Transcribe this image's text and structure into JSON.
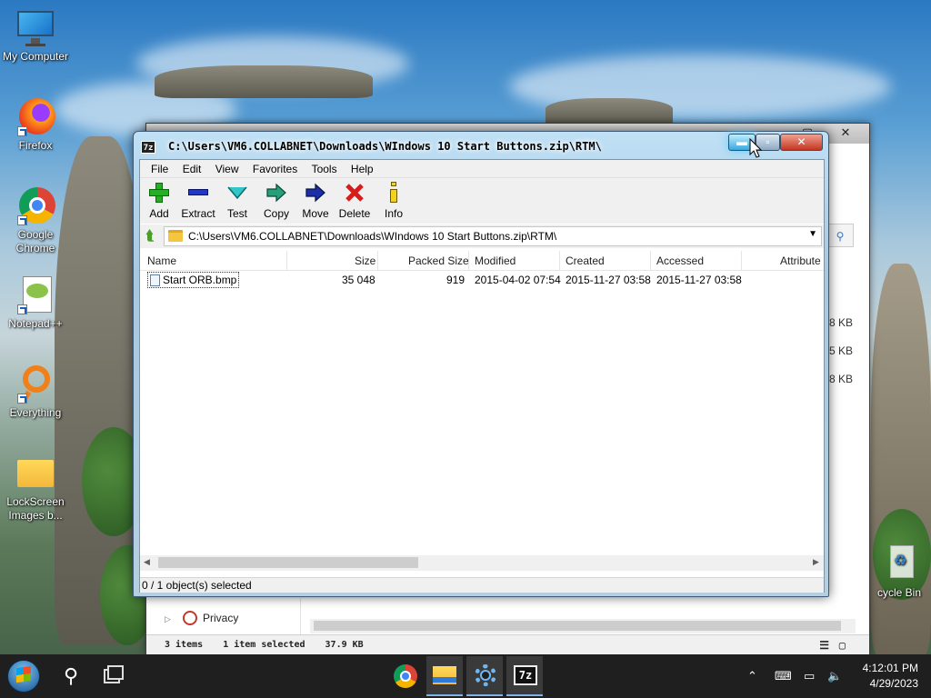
{
  "desktop": {
    "icons": [
      {
        "label": "My Computer",
        "icon": "monitor-icon"
      },
      {
        "label": "Firefox",
        "icon": "firefox-icon"
      },
      {
        "label": "Google Chrome",
        "icon": "chrome-icon"
      },
      {
        "label": "Notepad++",
        "icon": "notepadpp-icon"
      },
      {
        "label": "Everything",
        "icon": "everything-icon"
      },
      {
        "label": "LockScreen Images b...",
        "icon": "folder-icon"
      },
      {
        "label": "cycle Bin",
        "icon": "recycle-bin-icon"
      }
    ]
  },
  "bg_window": {
    "sizes": [
      "8 KB",
      "5 KB",
      "8 KB"
    ],
    "privacy_label": "Privacy",
    "status": {
      "items": "3 items",
      "selected": "1 item selected",
      "size": "37.9 KB"
    }
  },
  "window": {
    "title": "C:\\Users\\VM6.COLLABNET\\Downloads\\WIndows 10 Start Buttons.zip\\RTM\\",
    "app_icon_text": "7z",
    "menu": [
      "File",
      "Edit",
      "View",
      "Favorites",
      "Tools",
      "Help"
    ],
    "toolbar": [
      {
        "label": "Add",
        "icon": "plus-icon"
      },
      {
        "label": "Extract",
        "icon": "minus-icon"
      },
      {
        "label": "Test",
        "icon": "check-icon"
      },
      {
        "label": "Copy",
        "icon": "copy-arrow-icon"
      },
      {
        "label": "Move",
        "icon": "move-arrow-icon"
      },
      {
        "label": "Delete",
        "icon": "x-icon"
      },
      {
        "label": "Info",
        "icon": "info-icon"
      }
    ],
    "address": "C:\\Users\\VM6.COLLABNET\\Downloads\\WIndows 10 Start Buttons.zip\\RTM\\",
    "columns": [
      "Name",
      "Size",
      "Packed Size",
      "Modified",
      "Created",
      "Accessed",
      "Attribute"
    ],
    "rows": [
      {
        "name": "Start ORB.bmp",
        "size": "35 048",
        "packed": "919",
        "modified": "2015-04-02 07:54",
        "created": "2015-11-27 03:58",
        "accessed": "2015-11-27 03:58"
      }
    ],
    "status": "0 / 1 object(s) selected"
  },
  "taskbar": {
    "clock_time": "4:12:01 PM",
    "clock_date": "4/29/2023",
    "items": [
      "start-button",
      "search-icon",
      "task-view-icon",
      "chrome-icon",
      "file-explorer-icon",
      "settings-icon",
      "7zip-icon"
    ]
  }
}
